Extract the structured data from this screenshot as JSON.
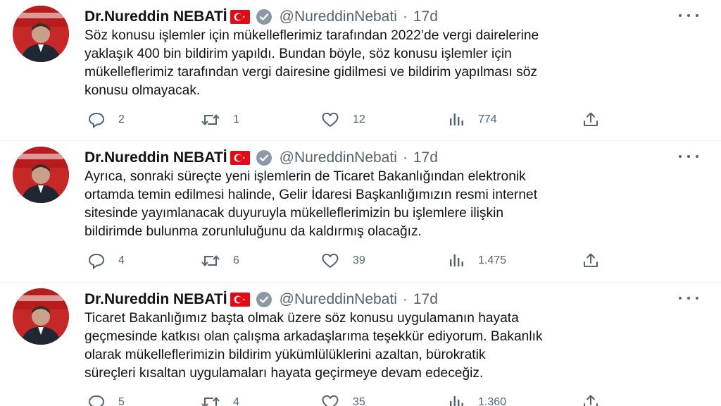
{
  "tweets": [
    {
      "author": {
        "display_name": "Dr.Nureddin NEBATİ",
        "handle": "@NureddinNebati",
        "time": "17d",
        "flag_icon": "turkey-flag-icon",
        "verified_icon": "verified-badge-icon"
      },
      "text": "Söz konusu işlemler için mükelleflerimiz tarafından 2022’de vergi dairelerine\nyaklaşık 400 bin bildirim yapıldı. Bundan böyle, söz konusu işlemler için\nmükelleflerimiz tarafından vergi dairesine gidilmesi ve bildirim yapılması söz\nkonusu olmayacak.",
      "replies": "2",
      "retweets": "1",
      "likes": "12",
      "views": "774"
    },
    {
      "author": {
        "display_name": "Dr.Nureddin NEBATİ",
        "handle": "@NureddinNebati",
        "time": "17d",
        "flag_icon": "turkey-flag-icon",
        "verified_icon": "verified-badge-icon"
      },
      "text": "Ayrıca, sonraki süreçte yeni işlemlerin de Ticaret Bakanlığından elektronik\nortamda temin edilmesi halinde, Gelir İdaresi Başkanlığımızın resmi internet\nsitesinde yayımlanacak duyuruyla mükelleflerimizin bu işlemlere ilişkin\nbildirimde bulunma zorunluluğunu da kaldırmış olacağız.",
      "replies": "4",
      "retweets": "6",
      "likes": "39",
      "views": "1.475"
    },
    {
      "author": {
        "display_name": "Dr.Nureddin NEBATİ",
        "handle": "@NureddinNebati",
        "time": "17d",
        "flag_icon": "turkey-flag-icon",
        "verified_icon": "verified-badge-icon"
      },
      "text": "Ticaret Bakanlığımız başta olmak üzere söz konusu uygulamanın hayata\ngeçmesinde katkısı olan çalışma arkadaşlarıma teşekkür ediyorum. Bakanlık\nolarak mükelleflerimizin bildirim yükümlülüklerini azaltan, bürokratik\nsüreçleri kısaltan uygulamaları hayata geçirmeye devam edeceğiz.",
      "replies": "5",
      "retweets": "4",
      "likes": "35",
      "views": "1.360"
    }
  ],
  "colors": {
    "text_primary": "#0f1419",
    "text_secondary": "#536471",
    "verified_blue": "#1d9bf0",
    "flag_red": "#e30a17",
    "divider": "#eff3f4"
  }
}
